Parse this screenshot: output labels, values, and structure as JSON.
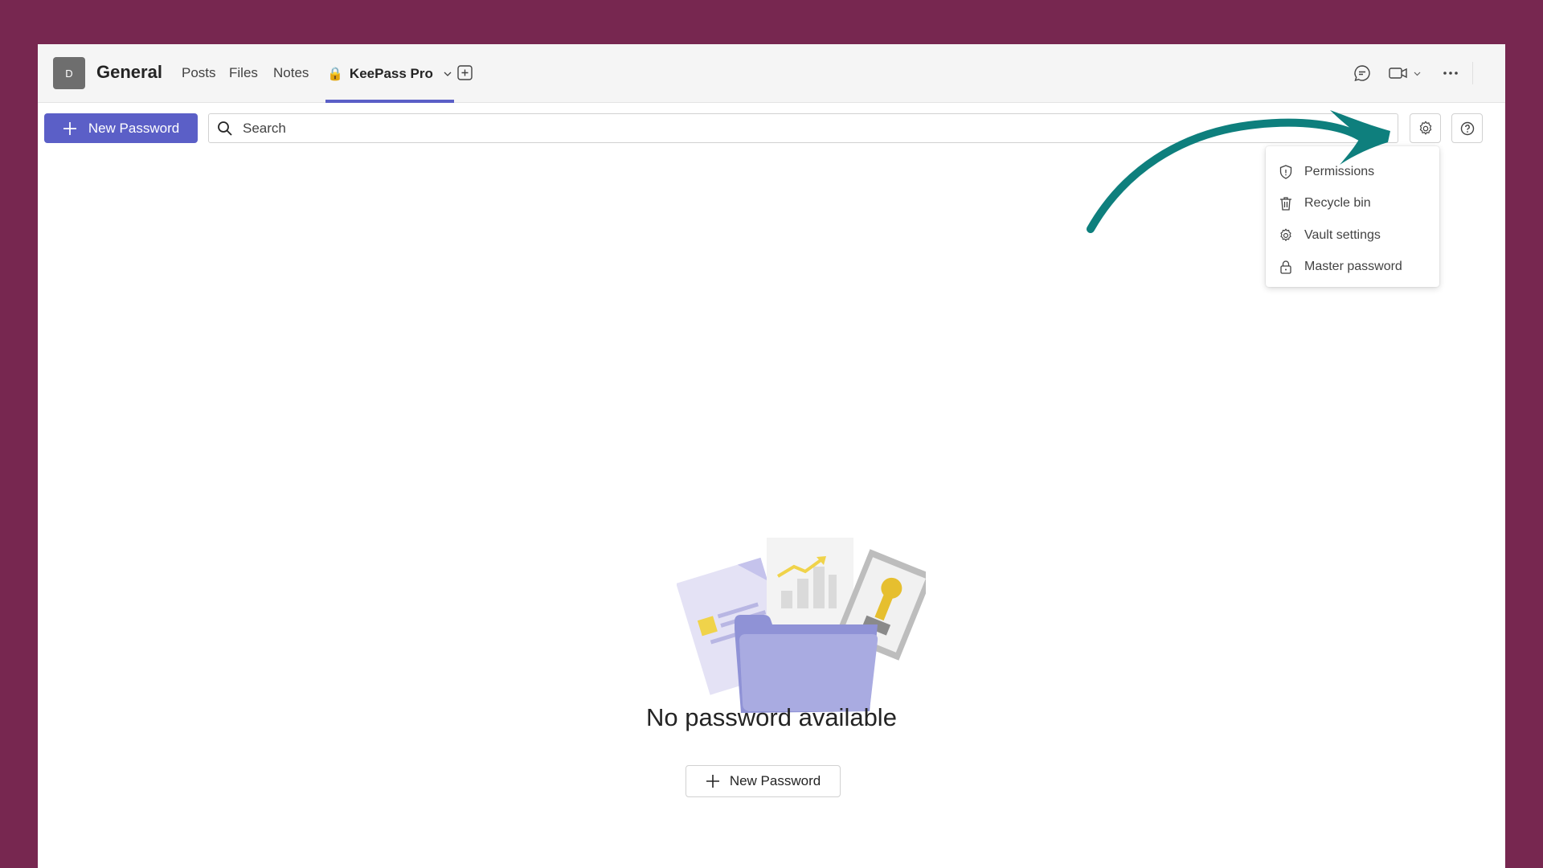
{
  "header": {
    "team_initial": "D",
    "channel_name": "General",
    "tabs": [
      {
        "label": "Posts"
      },
      {
        "label": "Files"
      },
      {
        "label": "Notes"
      },
      {
        "label": "KeePass Pro",
        "active": true
      }
    ]
  },
  "toolbar": {
    "new_password_label": "New Password",
    "search_placeholder": "Search"
  },
  "settings_menu": {
    "items": [
      {
        "label": "Permissions",
        "icon": "shield-icon"
      },
      {
        "label": "Recycle bin",
        "icon": "trash-icon"
      },
      {
        "label": "Vault settings",
        "icon": "gear-icon"
      },
      {
        "label": "Master password",
        "icon": "lock-icon"
      }
    ]
  },
  "empty_state": {
    "title": "No password available",
    "button_label": "New Password"
  },
  "colors": {
    "background": "#772750",
    "accent": "#5b5fc7",
    "annotation_arrow": "#0e7f7d"
  }
}
